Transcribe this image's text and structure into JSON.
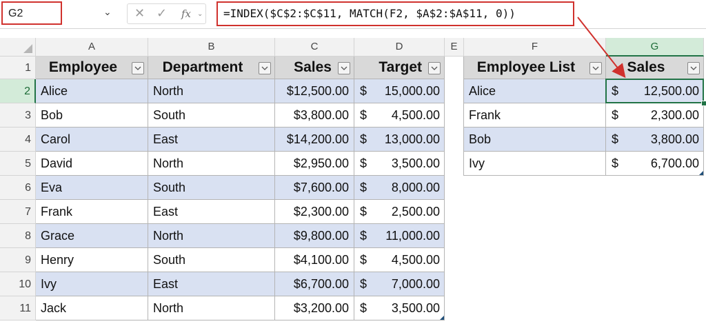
{
  "formula_bar": {
    "name_box": "G2",
    "formula": "=INDEX($C$2:$C$11, MATCH(F2, $A$2:$A$11, 0))",
    "cancel_icon": "close-icon",
    "enter_icon": "check-icon",
    "function_icon": "fx"
  },
  "sheet": {
    "columns": [
      "A",
      "B",
      "C",
      "D",
      "E",
      "F",
      "G"
    ],
    "active_column": "G",
    "rows": [
      "1",
      "2",
      "3",
      "4",
      "5",
      "6",
      "7",
      "8",
      "9",
      "10",
      "11"
    ],
    "active_row": "2",
    "active_cell": "G2"
  },
  "table1": {
    "headers": [
      "Employee",
      "Department",
      "Sales",
      "Target"
    ],
    "rows": [
      {
        "employee": "Alice",
        "department": "North",
        "sales": "$12,500.00",
        "target_cur": "$",
        "target": "15,000.00"
      },
      {
        "employee": "Bob",
        "department": "South",
        "sales": "$3,800.00",
        "target_cur": "$",
        "target": "4,500.00"
      },
      {
        "employee": "Carol",
        "department": "East",
        "sales": "$14,200.00",
        "target_cur": "$",
        "target": "13,000.00"
      },
      {
        "employee": "David",
        "department": "North",
        "sales": "$2,950.00",
        "target_cur": "$",
        "target": "3,500.00"
      },
      {
        "employee": "Eva",
        "department": "South",
        "sales": "$7,600.00",
        "target_cur": "$",
        "target": "8,000.00"
      },
      {
        "employee": "Frank",
        "department": "East",
        "sales": "$2,300.00",
        "target_cur": "$",
        "target": "2,500.00"
      },
      {
        "employee": "Grace",
        "department": "North",
        "sales": "$9,800.00",
        "target_cur": "$",
        "target": "11,000.00"
      },
      {
        "employee": "Henry",
        "department": "South",
        "sales": "$4,100.00",
        "target_cur": "$",
        "target": "4,500.00"
      },
      {
        "employee": "Ivy",
        "department": "East",
        "sales": "$6,700.00",
        "target_cur": "$",
        "target": "7,000.00"
      },
      {
        "employee": "Jack",
        "department": "North",
        "sales": "$3,200.00",
        "target_cur": "$",
        "target": "3,500.00"
      }
    ]
  },
  "table2": {
    "headers": [
      "Employee List",
      "Sales"
    ],
    "rows": [
      {
        "employee": "Alice",
        "sales_cur": "$",
        "sales": "12,500.00"
      },
      {
        "employee": "Frank",
        "sales_cur": "$",
        "sales": "2,300.00"
      },
      {
        "employee": "Bob",
        "sales_cur": "$",
        "sales": "3,800.00"
      },
      {
        "employee": "Ivy",
        "sales_cur": "$",
        "sales": "6,700.00"
      }
    ]
  },
  "colors": {
    "accent_green": "#217346",
    "header_fill": "#d9d9d9",
    "band_fill": "#d9e1f2",
    "annotation_red": "#d0312d"
  }
}
